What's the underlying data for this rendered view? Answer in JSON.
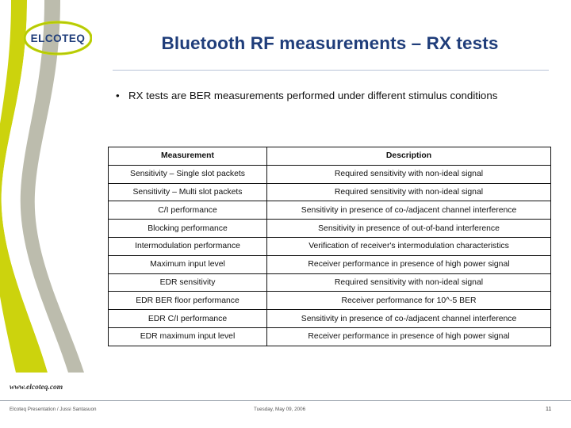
{
  "slide": {
    "title": "Bluetooth RF measurements – RX tests",
    "bullet": "RX tests are BER measurements performed under different stimulus conditions",
    "bullet_marker": "•"
  },
  "logo": {
    "text": "ELCOTEQ",
    "colors": {
      "text": "#1f3d7a",
      "accent_green": "#c3d600",
      "accent_gray": "#b9b9a8"
    }
  },
  "table": {
    "headers": [
      "Measurement",
      "Description"
    ],
    "rows": [
      [
        "Sensitivity – Single slot packets",
        "Required sensitivity with non-ideal signal"
      ],
      [
        "Sensitivity – Multi slot packets",
        "Required sensitivity with non-ideal signal"
      ],
      [
        "C/I performance",
        "Sensitivity in presence of co-/adjacent channel interference"
      ],
      [
        "Blocking performance",
        "Sensitivity in presence of out-of-band interference"
      ],
      [
        "Intermodulation performance",
        "Verification of receiver's intermodulation characteristics"
      ],
      [
        "Maximum input level",
        "Receiver performance in presence of high power signal"
      ],
      [
        "EDR sensitivity",
        "Required sensitivity with non-ideal signal"
      ],
      [
        "EDR BER floor performance",
        "Receiver performance for 10^-5 BER"
      ],
      [
        "EDR C/I performance",
        "Sensitivity in presence of co-/adjacent channel interference"
      ],
      [
        "EDR maximum input level",
        "Receiver performance in presence of high power signal"
      ]
    ]
  },
  "footer": {
    "url": "www.elcoteq.com",
    "left": "Elcoteq Presentation / Jussi Santasuon",
    "center": "Tuesday, May 09, 2006",
    "page": "11"
  }
}
